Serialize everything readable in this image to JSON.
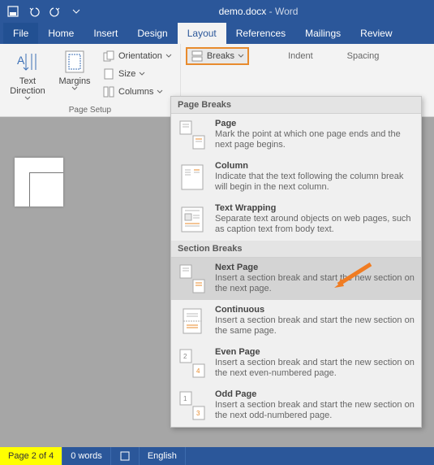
{
  "title": {
    "filename": "demo.docx",
    "app": "Word"
  },
  "tabs": [
    "File",
    "Home",
    "Insert",
    "Design",
    "Layout",
    "References",
    "Mailings",
    "Review"
  ],
  "active_tab": "Layout",
  "ribbon": {
    "text_direction": "Text\nDirection",
    "margins": "Margins",
    "orientation": "Orientation",
    "size": "Size",
    "columns": "Columns",
    "breaks": "Breaks",
    "indent": "Indent",
    "spacing": "Spacing",
    "group_page_setup": "Page Setup"
  },
  "dropdown": {
    "header_page": "Page Breaks",
    "header_section": "Section Breaks",
    "items": {
      "page": {
        "title": "Page",
        "desc": "Mark the point at which one page ends and the next page begins."
      },
      "column": {
        "title": "Column",
        "desc": "Indicate that the text following the column break will begin in the next column."
      },
      "textwrap": {
        "title": "Text Wrapping",
        "desc": "Separate text around objects on web pages, such as caption text from body text."
      },
      "nextpage": {
        "title": "Next Page",
        "desc": "Insert a section break and start the new section on the next page."
      },
      "continuous": {
        "title": "Continuous",
        "desc": "Insert a section break and start the new section on the same page."
      },
      "evenpage": {
        "title": "Even Page",
        "desc": "Insert a section break and start the new section on the next even-numbered page."
      },
      "oddpage": {
        "title": "Odd Page",
        "desc": "Insert a section break and start the new section on the next odd-numbered page."
      }
    }
  },
  "status": {
    "page": "Page 2 of 4",
    "words": "0 words",
    "lang": "English"
  }
}
